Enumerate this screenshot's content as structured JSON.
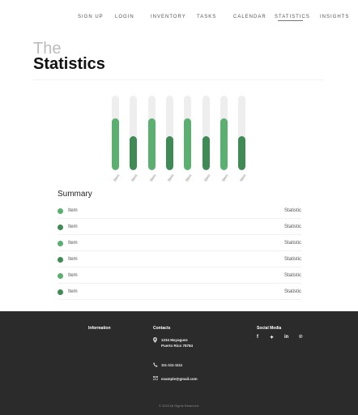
{
  "nav": {
    "items": [
      "SIGN UP",
      "LOGIN",
      "INVENTORY",
      "TASKS",
      "CALENDAR",
      "STATISTICS",
      "INSIGHTS"
    ],
    "active": "STATISTICS"
  },
  "header": {
    "title_small": "The",
    "title_big": "Statistics"
  },
  "chart_data": {
    "type": "bar",
    "categories": [
      "Item",
      "Item",
      "Item",
      "Item",
      "Item",
      "Item",
      "Item",
      "Item"
    ],
    "values": [
      70,
      46,
      70,
      46,
      70,
      46,
      70,
      46
    ],
    "ylim": [
      0,
      100
    ],
    "colors": [
      "#5aaf71",
      "#3f8a55",
      "#5aaf71",
      "#3f8a55",
      "#5aaf71",
      "#3f8a55",
      "#5aaf71",
      "#3f8a55"
    ],
    "track_color": "#eeeeee",
    "grid": false,
    "title": "",
    "xlabel": "",
    "ylabel": ""
  },
  "summary": {
    "title": "Summary",
    "rows": [
      {
        "label": "Item",
        "value": "Statistic",
        "color": "#5aaf71"
      },
      {
        "label": "Item",
        "value": "Statistic",
        "color": "#3f8a55"
      },
      {
        "label": "Item",
        "value": "Statistic",
        "color": "#5aaf71"
      },
      {
        "label": "Item",
        "value": "Statistic",
        "color": "#3f8a55"
      },
      {
        "label": "Item",
        "value": "Statistic",
        "color": "#5aaf71"
      },
      {
        "label": "Item",
        "value": "Statistic",
        "color": "#3f8a55"
      }
    ]
  },
  "footer": {
    "information_heading": "Information",
    "contacts_heading": "Contacts",
    "address_line1": "1234 Mayaguez",
    "address_line2": "Puerto Rico 78784",
    "phone": "111-111-1111",
    "email": "example@gmail.com",
    "social_heading": "Social Media",
    "social": [
      {
        "icon": "facebook-icon",
        "glyph": "f"
      },
      {
        "icon": "twitter-icon",
        "glyph": "✦"
      },
      {
        "icon": "linkedin-icon",
        "glyph": "in"
      },
      {
        "icon": "pinterest-icon",
        "glyph": "℗"
      }
    ],
    "copyright": "© 2023 All Rights Reserved."
  }
}
